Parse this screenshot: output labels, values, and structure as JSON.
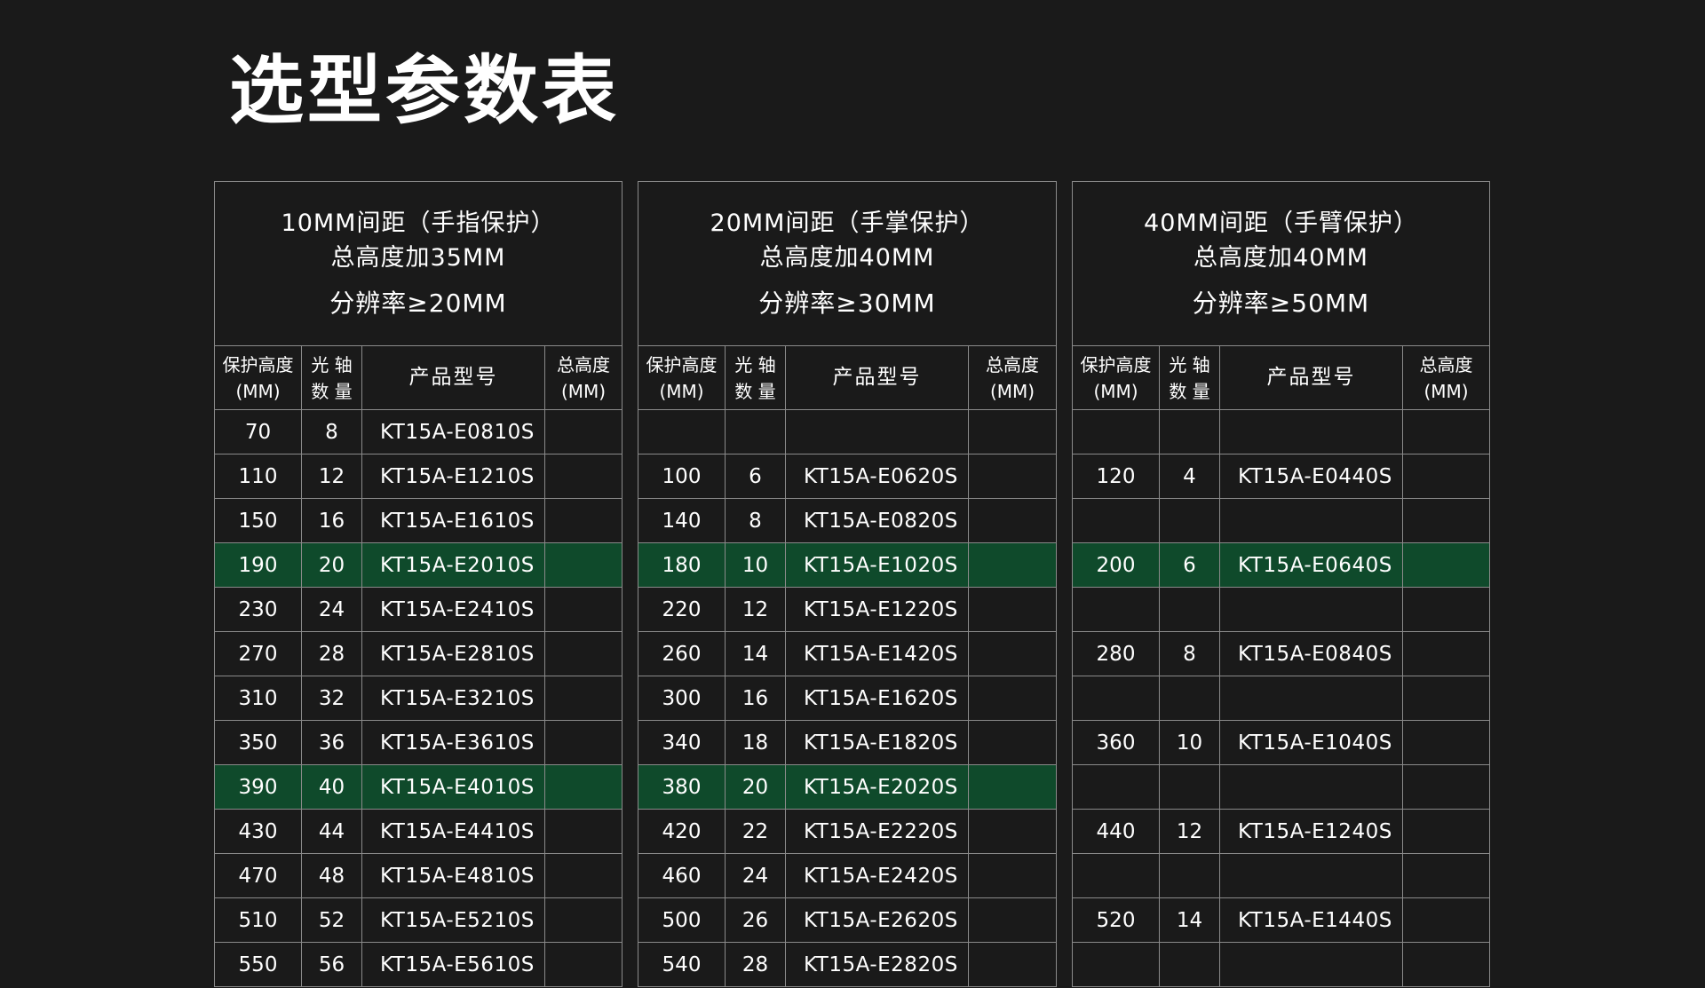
{
  "title": "选型参数表",
  "colors": {
    "background": "#1a1a1a",
    "highlight": "#0f4a2b",
    "border": "#8a8a8a"
  },
  "tables": [
    {
      "header": {
        "line1": "10MM间距（手指保护）",
        "line2": "总高度加35MM",
        "line3": "分辨率≥20MM"
      },
      "columns": [
        {
          "l1": "保护高度",
          "l2": "(MM)"
        },
        {
          "l1": "光 轴",
          "l2": "数 量"
        },
        {
          "l1": "产品型号",
          "l2": ""
        },
        {
          "l1": "总高度",
          "l2": "(MM)"
        }
      ],
      "rows": [
        {
          "h": "70",
          "n": "8",
          "m": "KT15A-E0810S",
          "t": "",
          "hl": false
        },
        {
          "h": "110",
          "n": "12",
          "m": "KT15A-E1210S",
          "t": "",
          "hl": false
        },
        {
          "h": "150",
          "n": "16",
          "m": "KT15A-E1610S",
          "t": "",
          "hl": false
        },
        {
          "h": "190",
          "n": "20",
          "m": "KT15A-E2010S",
          "t": "",
          "hl": true
        },
        {
          "h": "230",
          "n": "24",
          "m": "KT15A-E2410S",
          "t": "",
          "hl": false
        },
        {
          "h": "270",
          "n": "28",
          "m": "KT15A-E2810S",
          "t": "",
          "hl": false
        },
        {
          "h": "310",
          "n": "32",
          "m": "KT15A-E3210S",
          "t": "",
          "hl": false
        },
        {
          "h": "350",
          "n": "36",
          "m": "KT15A-E3610S",
          "t": "",
          "hl": false
        },
        {
          "h": "390",
          "n": "40",
          "m": "KT15A-E4010S",
          "t": "",
          "hl": true
        },
        {
          "h": "430",
          "n": "44",
          "m": "KT15A-E4410S",
          "t": "",
          "hl": false
        },
        {
          "h": "470",
          "n": "48",
          "m": "KT15A-E4810S",
          "t": "",
          "hl": false
        },
        {
          "h": "510",
          "n": "52",
          "m": "KT15A-E5210S",
          "t": "",
          "hl": false
        },
        {
          "h": "550",
          "n": "56",
          "m": "KT15A-E5610S",
          "t": "",
          "hl": false
        }
      ]
    },
    {
      "header": {
        "line1": "20MM间距（手掌保护）",
        "line2": "总高度加40MM",
        "line3": "分辨率≥30MM"
      },
      "columns": [
        {
          "l1": "保护高度",
          "l2": "(MM)"
        },
        {
          "l1": "光 轴",
          "l2": "数 量"
        },
        {
          "l1": "产品型号",
          "l2": ""
        },
        {
          "l1": "总高度",
          "l2": "(MM)"
        }
      ],
      "rows": [
        {
          "h": "",
          "n": "",
          "m": "",
          "t": "",
          "hl": false
        },
        {
          "h": "100",
          "n": "6",
          "m": "KT15A-E0620S",
          "t": "",
          "hl": false
        },
        {
          "h": "140",
          "n": "8",
          "m": "KT15A-E0820S",
          "t": "",
          "hl": false
        },
        {
          "h": "180",
          "n": "10",
          "m": "KT15A-E1020S",
          "t": "",
          "hl": true
        },
        {
          "h": "220",
          "n": "12",
          "m": "KT15A-E1220S",
          "t": "",
          "hl": false
        },
        {
          "h": "260",
          "n": "14",
          "m": "KT15A-E1420S",
          "t": "",
          "hl": false
        },
        {
          "h": "300",
          "n": "16",
          "m": "KT15A-E1620S",
          "t": "",
          "hl": false
        },
        {
          "h": "340",
          "n": "18",
          "m": "KT15A-E1820S",
          "t": "",
          "hl": false
        },
        {
          "h": "380",
          "n": "20",
          "m": "KT15A-E2020S",
          "t": "",
          "hl": true
        },
        {
          "h": "420",
          "n": "22",
          "m": "KT15A-E2220S",
          "t": "",
          "hl": false
        },
        {
          "h": "460",
          "n": "24",
          "m": "KT15A-E2420S",
          "t": "",
          "hl": false
        },
        {
          "h": "500",
          "n": "26",
          "m": "KT15A-E2620S",
          "t": "",
          "hl": false
        },
        {
          "h": "540",
          "n": "28",
          "m": "KT15A-E2820S",
          "t": "",
          "hl": false
        }
      ]
    },
    {
      "header": {
        "line1": "40MM间距（手臂保护）",
        "line2": "总高度加40MM",
        "line3": "分辨率≥50MM"
      },
      "columns": [
        {
          "l1": "保护高度",
          "l2": "(MM)"
        },
        {
          "l1": "光 轴",
          "l2": "数 量"
        },
        {
          "l1": "产品型号",
          "l2": ""
        },
        {
          "l1": "总高度",
          "l2": "(MM)"
        }
      ],
      "rows": [
        {
          "h": "",
          "n": "",
          "m": "",
          "t": "",
          "hl": false
        },
        {
          "h": "120",
          "n": "4",
          "m": "KT15A-E0440S",
          "t": "",
          "hl": false
        },
        {
          "h": "",
          "n": "",
          "m": "",
          "t": "",
          "hl": false
        },
        {
          "h": "200",
          "n": "6",
          "m": "KT15A-E0640S",
          "t": "",
          "hl": true
        },
        {
          "h": "",
          "n": "",
          "m": "",
          "t": "",
          "hl": false
        },
        {
          "h": "280",
          "n": "8",
          "m": "KT15A-E0840S",
          "t": "",
          "hl": false
        },
        {
          "h": "",
          "n": "",
          "m": "",
          "t": "",
          "hl": false
        },
        {
          "h": "360",
          "n": "10",
          "m": "KT15A-E1040S",
          "t": "",
          "hl": false
        },
        {
          "h": "",
          "n": "",
          "m": "",
          "t": "",
          "hl": false
        },
        {
          "h": "440",
          "n": "12",
          "m": "KT15A-E1240S",
          "t": "",
          "hl": false
        },
        {
          "h": "",
          "n": "",
          "m": "",
          "t": "",
          "hl": false
        },
        {
          "h": "520",
          "n": "14",
          "m": "KT15A-E1440S",
          "t": "",
          "hl": false
        },
        {
          "h": "",
          "n": "",
          "m": "",
          "t": "",
          "hl": false
        }
      ]
    }
  ]
}
